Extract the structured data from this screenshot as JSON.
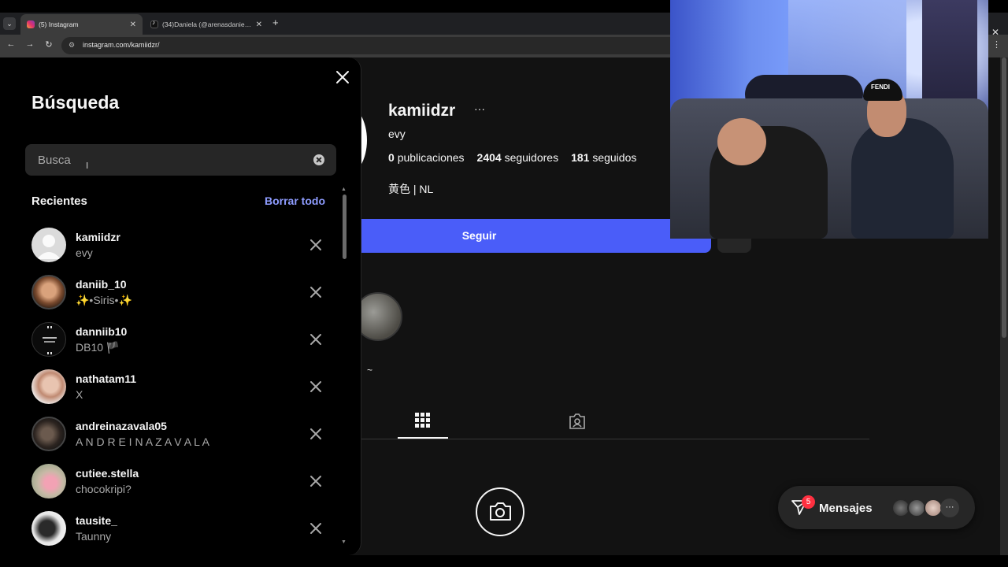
{
  "browser": {
    "tabs": [
      {
        "title": "(5) Instagram",
        "active": true
      },
      {
        "title": "(34)Daniela (@arenasdanielab)",
        "active": false
      }
    ],
    "url": "instagram.com/kamiidzr/"
  },
  "search_panel": {
    "title": "Búsqueda",
    "search_placeholder": "Busca",
    "recents_title": "Recientes",
    "clear_all_label": "Borrar todo",
    "recent_items": [
      {
        "username": "kamiidzr",
        "subtitle": "evy"
      },
      {
        "username": "daniib_10",
        "subtitle": "✨•Siris•✨"
      },
      {
        "username": "danniib10",
        "subtitle": "DB10 🏴"
      },
      {
        "username": "nathatam11",
        "subtitle": "X"
      },
      {
        "username": "andreinazavala05",
        "subtitle": "A N D R E I N A Z A V A L A"
      },
      {
        "username": "cutiee.stella",
        "subtitle": "chocokripi?"
      },
      {
        "username": "tausite_",
        "subtitle": "Taunny"
      }
    ]
  },
  "profile": {
    "username": "kamiidzr",
    "full_name": "evy",
    "posts_count": "0",
    "posts_label": "publicaciones",
    "followers_count": "2404",
    "followers_label": "seguidores",
    "following_count": "181",
    "following_label": "seguidos",
    "bio": "黄色 | NL",
    "follow_button_label": "Seguir",
    "highlight_label": "~"
  },
  "messages": {
    "label": "Mensajes",
    "unread_count": "5"
  },
  "webcam": {
    "cap_text": "FENDI"
  },
  "colors": {
    "follow_blue": "#4a5df9",
    "link_blue": "#8e9cff",
    "badge_red": "#ff3040",
    "panel_bg": "#000000",
    "page_bg": "#121212"
  }
}
